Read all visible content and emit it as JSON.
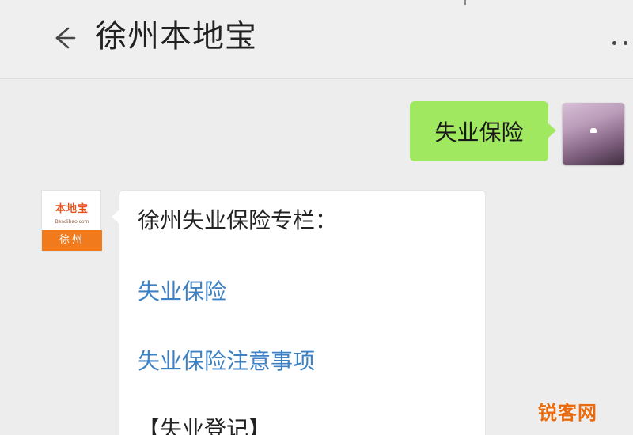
{
  "header": {
    "title": "徐州本地宝",
    "back_icon": "back-arrow-icon",
    "more_icon": "more-dots-icon"
  },
  "outgoing": {
    "text": "失业保险"
  },
  "account_avatar": {
    "logo_text": "本地宝",
    "logo_subtext": "Bendibao.com",
    "city": "徐州"
  },
  "incoming": {
    "heading": "徐州失业保险专栏：",
    "links": [
      "失业保险",
      "失业保险注意事项"
    ],
    "partial_text": "【失业登记】"
  },
  "watermark": "锐客网",
  "colors": {
    "background": "#ededed",
    "outgoing_bubble": "#9fe85f",
    "link": "#3d80c4",
    "brand_orange": "#f07a1c"
  }
}
